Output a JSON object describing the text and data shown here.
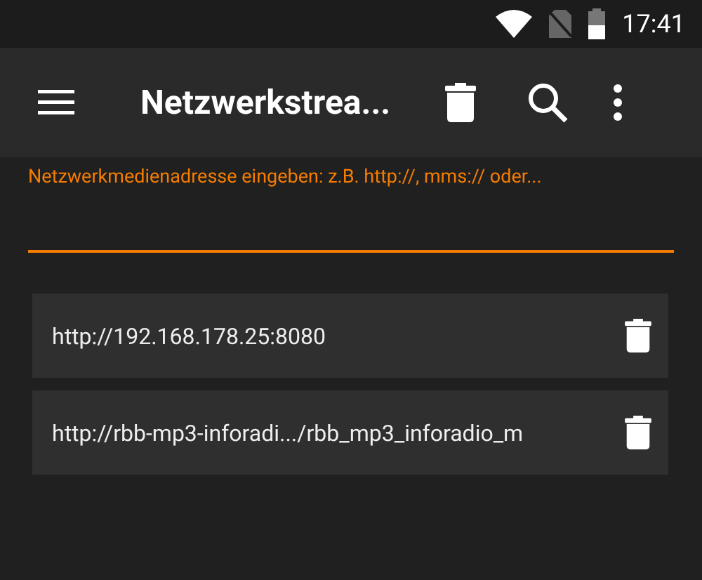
{
  "status_bar": {
    "time": "17:41"
  },
  "toolbar": {
    "title": "Netzwerkstrea..."
  },
  "address_field": {
    "label": "Netzwerkmedienadresse eingeben: z.B. http://, mms:// oder..."
  },
  "history": [
    {
      "url": "http://192.168.178.25:8080"
    },
    {
      "url": "http://rbb-mp3-inforadi.../rbb_mp3_inforadio_m"
    }
  ]
}
